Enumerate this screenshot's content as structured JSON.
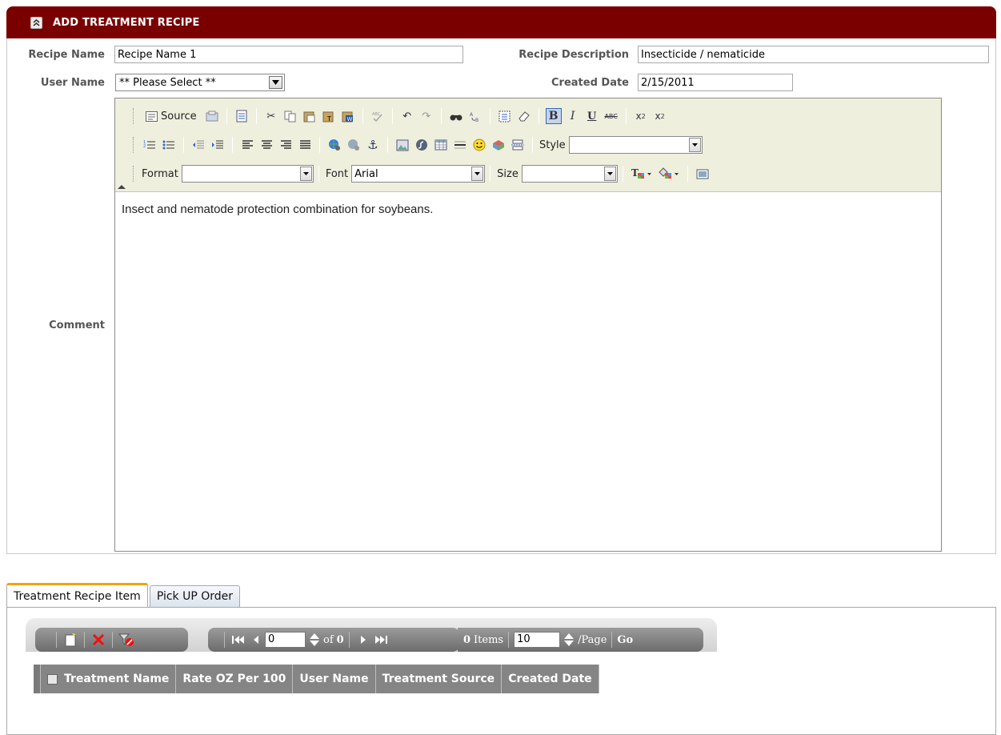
{
  "header": {
    "title": "ADD TREATMENT RECIPE"
  },
  "form": {
    "recipe_name_label": "Recipe Name",
    "recipe_name_value": "Recipe Name 1",
    "recipe_description_label": "Recipe Description",
    "recipe_description_value": "Insecticide / nematicide",
    "user_name_label": "User Name",
    "user_name_selected": "** Please Select **",
    "created_date_label": "Created Date",
    "created_date_value": "2/15/2011",
    "comment_label": "Comment"
  },
  "editor": {
    "source_label": "Source",
    "style_label": "Style",
    "style_value": "",
    "format_label": "Format",
    "format_value": "",
    "font_label": "Font",
    "font_value": "Arial",
    "size_label": "Size",
    "size_value": "",
    "content": "Insect and nematode protection combination for soybeans."
  },
  "tabs": [
    {
      "label": "Treatment Recipe Item",
      "selected": true
    },
    {
      "label": "Pick UP Order",
      "selected": false
    }
  ],
  "grid": {
    "pager": {
      "page_value": "0",
      "of_text": "of",
      "page_count": "0",
      "items_count": "0",
      "items_label": "Items",
      "page_size": "10",
      "per_page_label": "/Page",
      "go_label": "Go"
    },
    "columns": [
      "Treatment Name",
      "Rate OZ Per 100",
      "User Name",
      "Treatment Source",
      "Created Date"
    ]
  },
  "colors": {
    "header_bg": "#7a0000",
    "toolbar_bg": "#efefde",
    "tab_accent": "#f0a30a",
    "grid_header_bg": "#858585"
  }
}
